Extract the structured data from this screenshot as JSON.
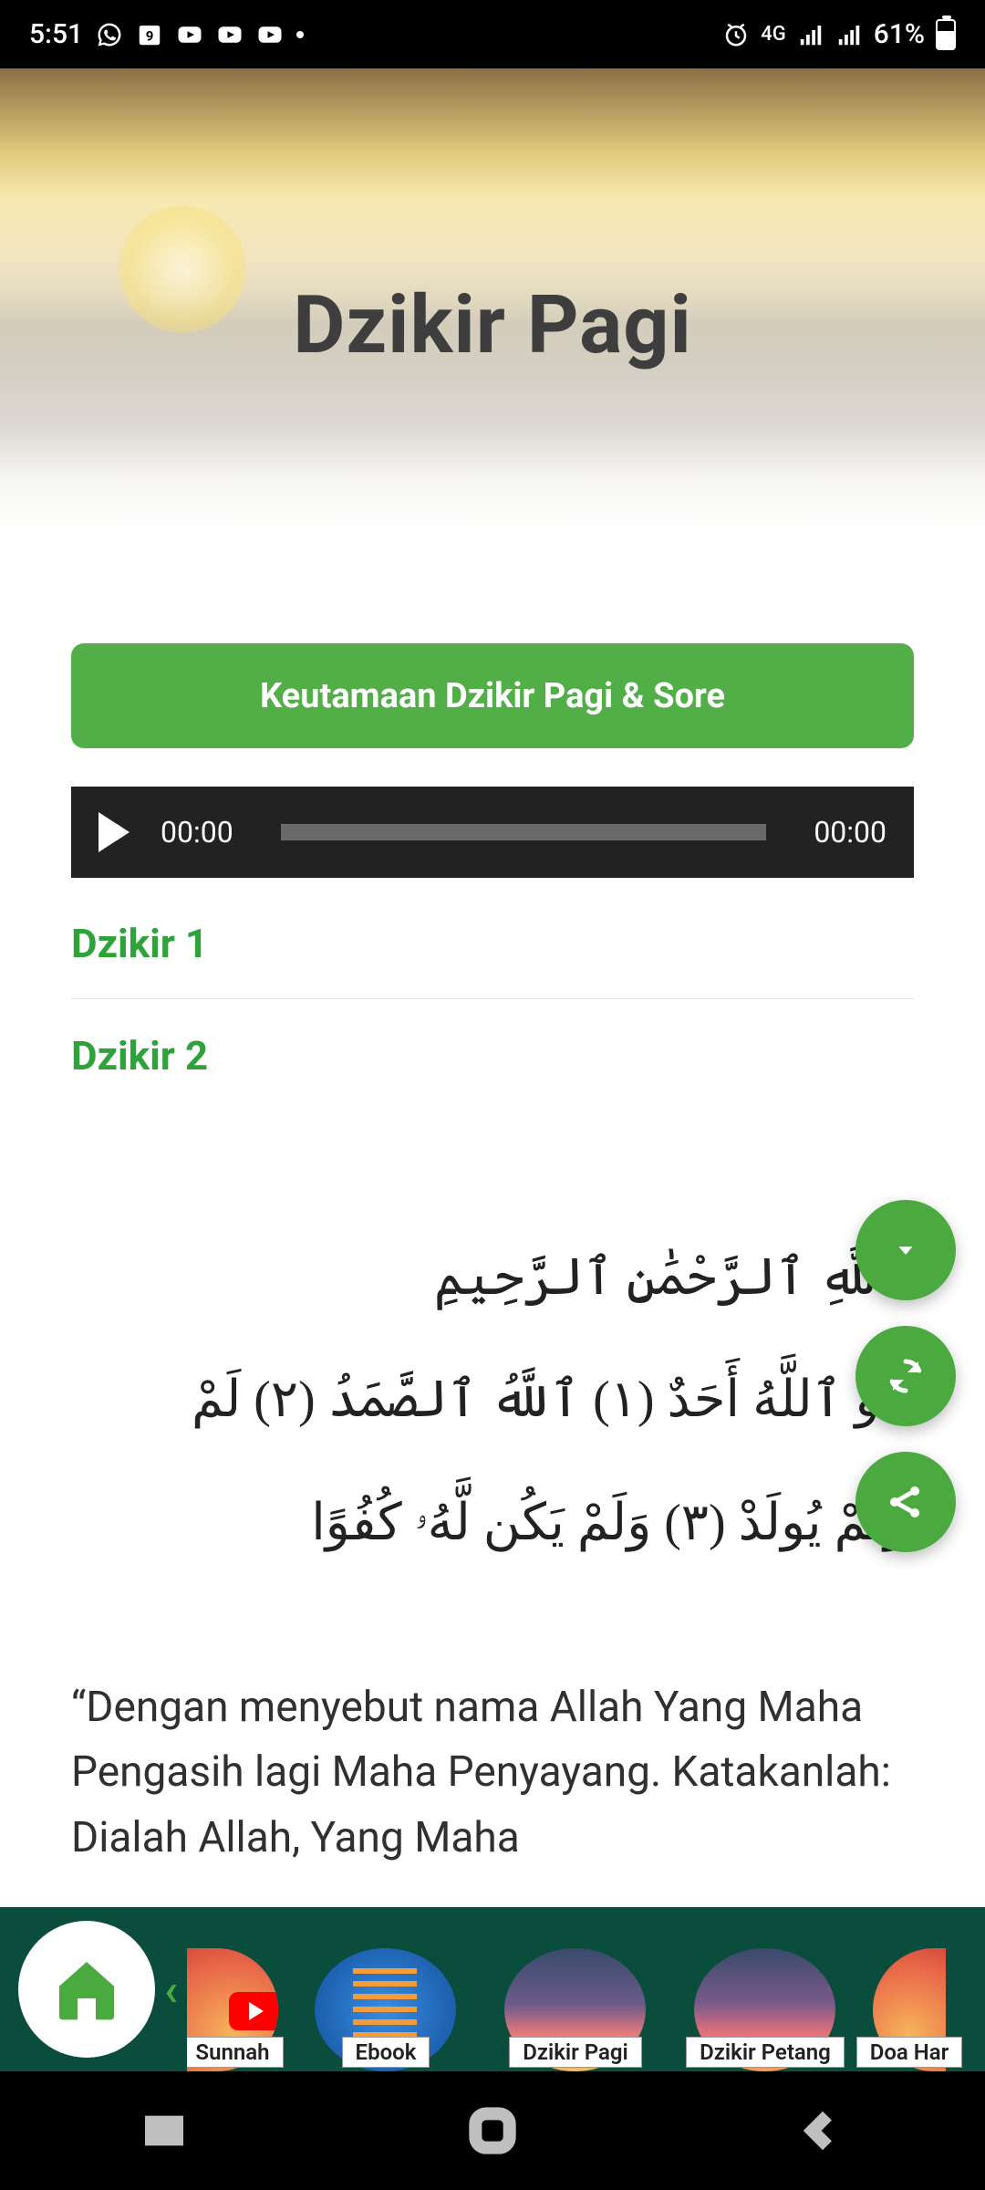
{
  "status": {
    "time": "5:51",
    "network_label": "4G",
    "battery_pct": "61%"
  },
  "hero": {
    "title": "Dzikir Pagi"
  },
  "virtue_button": "Keutamaan Dzikir Pagi & Sore",
  "audio": {
    "elapsed": "00:00",
    "total": "00:00"
  },
  "sections": {
    "dzikir1": "Dzikir 1",
    "dzikir2": "Dzikir 2"
  },
  "arabic": {
    "bismillah": "ٱللَّهِ ٱلرَّحْمَٰنِ ٱلرَّحِيمِ",
    "line1": "هُوَ ٱللَّهُ أَحَدٌ (١) ٱللَّهُ ٱلصَّمَدُ (٢) لَمْ",
    "line2": "وَلَمْ يُولَدْ (٣) وَلَمْ يَكُن لَّهُۥ كُفُوًا"
  },
  "translation": "“Dengan menyebut nama Allah Yang Maha Pengasih lagi Maha Penyayang. Katakanlah: Dialah Allah, Yang Maha",
  "dock": {
    "items": [
      {
        "label": "Sunnah"
      },
      {
        "label": "Ebook"
      },
      {
        "label": "Dzikir Pagi"
      },
      {
        "label": "Dzikir Petang"
      },
      {
        "label": "Doa Har"
      }
    ]
  }
}
